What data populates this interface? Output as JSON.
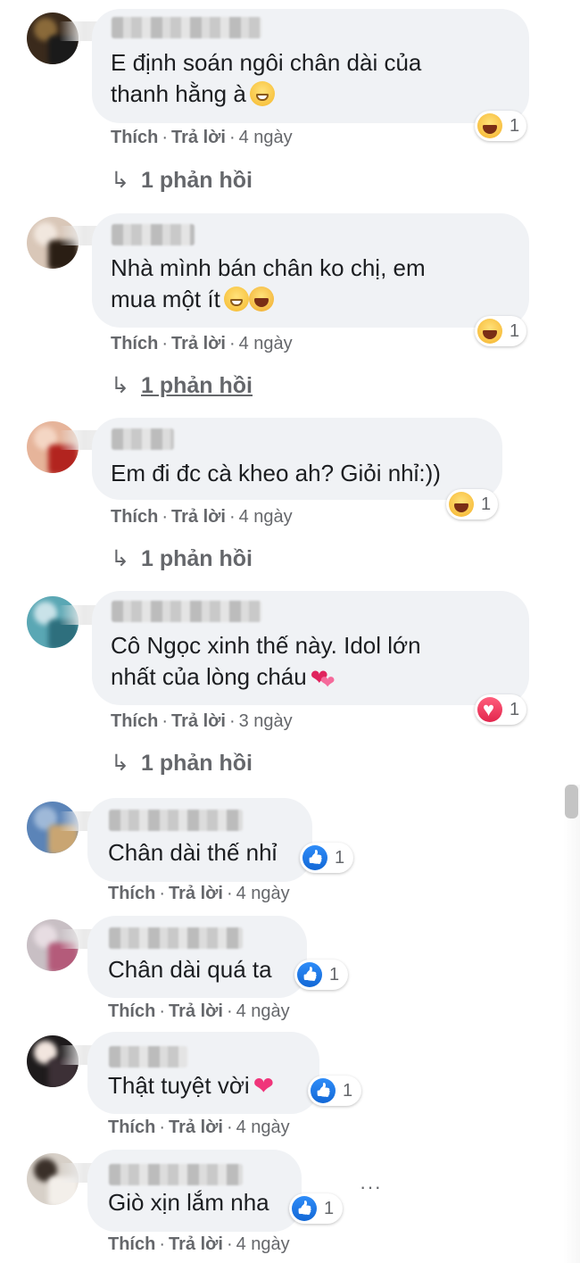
{
  "comments": [
    {
      "text_lines": [
        "E định soán ngôi chân dài của",
        "thanh hằng à"
      ],
      "emoji": [
        "grin-icon"
      ],
      "actions": {
        "like": "Thích",
        "reply": "Trả lời",
        "time": "4 ngày"
      },
      "reaction": {
        "icon": "haha-icon",
        "count": "1"
      },
      "replies": "1 phản hồi"
    },
    {
      "text_lines": [
        "Nhà mình bán chân ko chị, em",
        "mua một ít"
      ],
      "emoji": [
        "smile-icon",
        "rofl-icon"
      ],
      "actions": {
        "like": "Thích",
        "reply": "Trả lời",
        "time": "4 ngày"
      },
      "reaction": {
        "icon": "haha-icon",
        "count": "1"
      },
      "replies": "1 phản hồi"
    },
    {
      "text_lines": [
        "Em đi đc cà kheo ah? Giỏi nhỉ:))"
      ],
      "emoji": [],
      "actions": {
        "like": "Thích",
        "reply": "Trả lời",
        "time": "4 ngày"
      },
      "reaction": {
        "icon": "haha-icon",
        "count": "1"
      },
      "replies": "1 phản hồi"
    },
    {
      "text_lines": [
        "Cô Ngọc xinh thế này. Idol lớn",
        "nhất của lòng cháu"
      ],
      "emoji": [
        "two-hearts-icon"
      ],
      "actions": {
        "like": "Thích",
        "reply": "Trả lời",
        "time": "3 ngày"
      },
      "reaction": {
        "icon": "love-icon",
        "count": "1"
      },
      "replies": "1 phản hồi"
    },
    {
      "text_lines": [
        "Chân dài thế nhỉ"
      ],
      "emoji": [],
      "actions": {
        "like": "Thích",
        "reply": "Trả lời",
        "time": "4 ngày"
      },
      "reaction": {
        "icon": "like-icon",
        "count": "1"
      }
    },
    {
      "text_lines": [
        "Chân dài quá ta"
      ],
      "emoji": [],
      "actions": {
        "like": "Thích",
        "reply": "Trả lời",
        "time": "4 ngày"
      },
      "reaction": {
        "icon": "like-icon",
        "count": "1"
      }
    },
    {
      "text_lines": [
        "Thật tuyệt vời"
      ],
      "emoji": [
        "sparkling-heart-icon"
      ],
      "actions": {
        "like": "Thích",
        "reply": "Trả lời",
        "time": "4 ngày"
      },
      "reaction": {
        "icon": "like-icon",
        "count": "1"
      }
    },
    {
      "text_lines": [
        "Giò xịn lắm nha"
      ],
      "emoji": [],
      "actions": {
        "like": "Thích",
        "reply": "Trả lời",
        "time": "4 ngày"
      },
      "reaction": {
        "icon": "like-icon",
        "count": "1"
      }
    }
  ],
  "more_options": "···",
  "colors": {
    "bubble": "#f0f2f5",
    "meta_text": "#65676b",
    "like_blue": "#1877f2",
    "love_red": "#e2264d",
    "haha_yellow": "#f7b928"
  }
}
